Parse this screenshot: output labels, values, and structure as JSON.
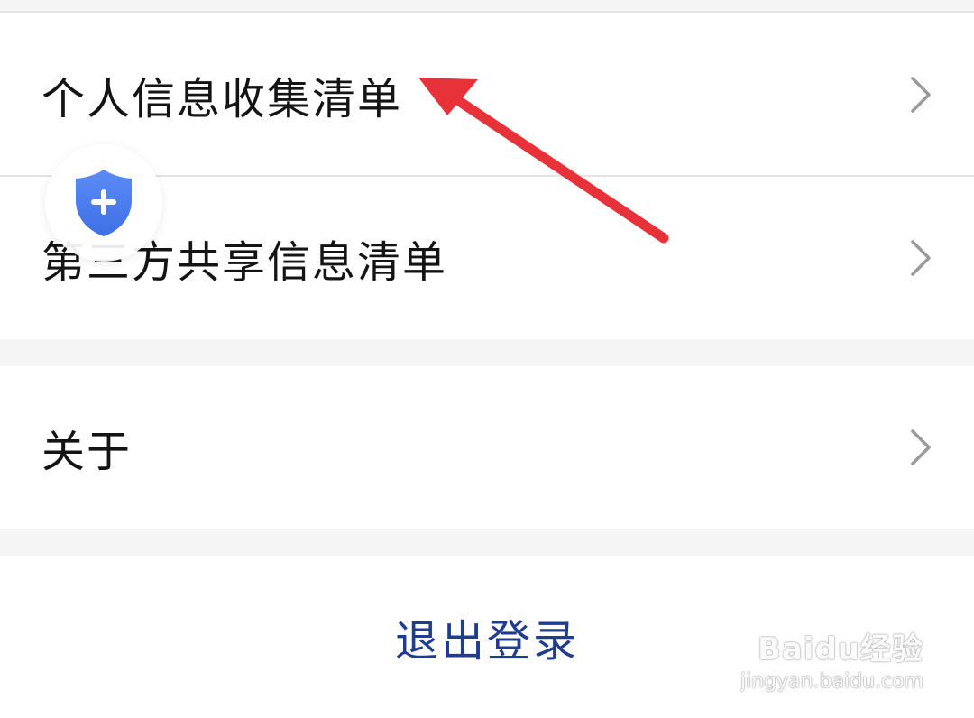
{
  "menu": {
    "items": [
      {
        "label": "个人信息收集清单",
        "icon": "chevron-right-icon"
      },
      {
        "label": "第三方共享信息清单",
        "icon": "chevron-right-icon"
      },
      {
        "label": "关于",
        "icon": "chevron-right-icon"
      }
    ]
  },
  "logout": {
    "label": "退出登录"
  },
  "floating_badge": {
    "icon": "shield-plus-icon",
    "color": "#4a7cf0"
  },
  "annotation": {
    "icon": "red-arrow-icon",
    "color": "#e8323a"
  },
  "watermark": {
    "brand": "Baidu经验",
    "url": "jingyan.baidu.com"
  },
  "colors": {
    "background": "#f5f5f5",
    "card": "#ffffff",
    "text": "#141414",
    "logout": "#1f3c8f",
    "chevron": "#9a9a9a",
    "divider": "#e4e4e4"
  }
}
